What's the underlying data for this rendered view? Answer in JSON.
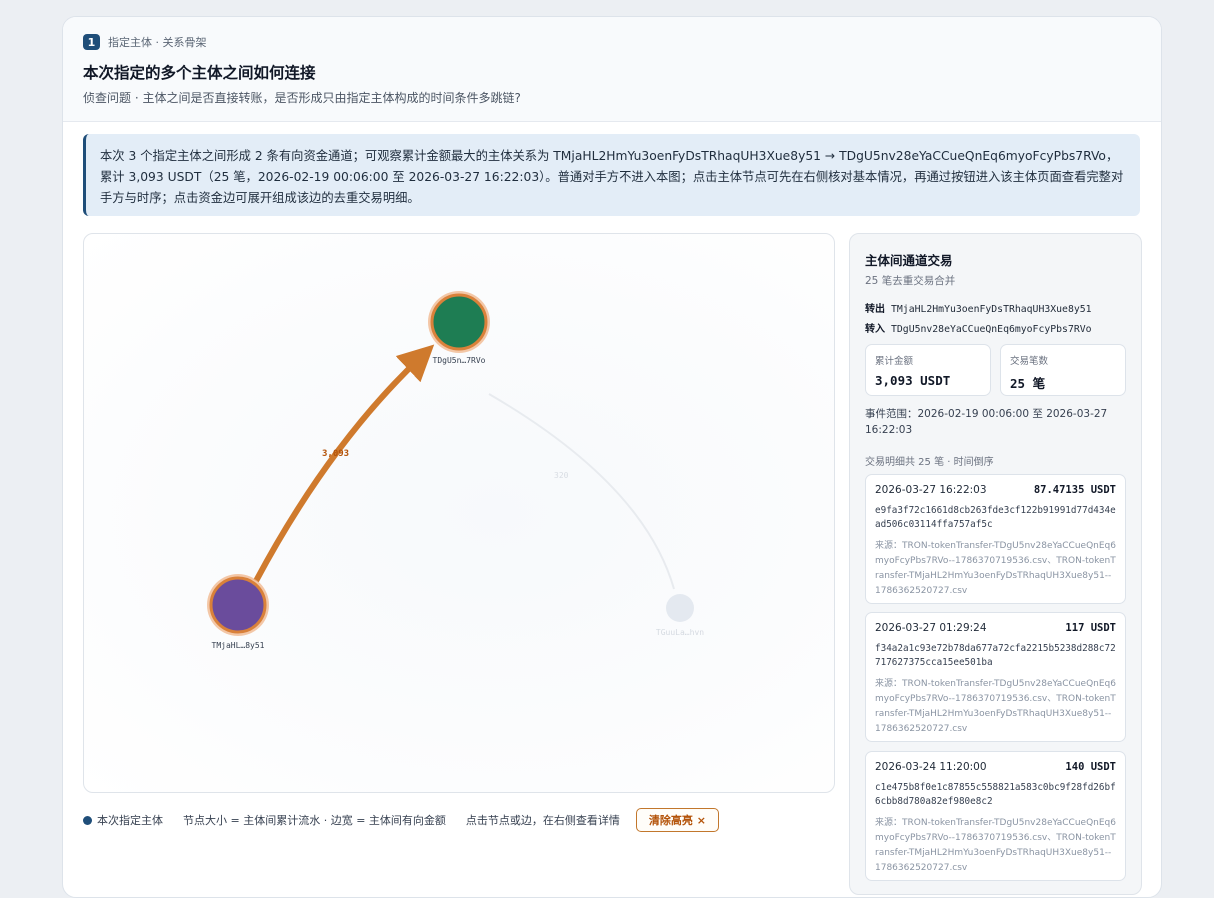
{
  "header": {
    "step_number": "1",
    "step_label": "指定主体 · 关系骨架",
    "title": "本次指定的多个主体之间如何连接",
    "subtitle": "侦查问题 · 主体之间是否直接转账，是否形成只由指定主体构成的时间条件多跳链?"
  },
  "notice": {
    "text": "本次 3 个指定主体之间形成 2 条有向资金通道；可观察累计金额最大的主体关系为 TMjaHL2HmYu3oenFyDsTRhaqUH3Xue8y51 → TDgU5nv28eYaCCueQnEq6myoFcyPbs7RVo，累计 3,093 USDT（25 笔，2026-02-19 00:06:00 至 2026-03-27 16:22:03）。普通对手方不进入本图；点击主体节点可先在右侧核对基本情况，再通过按钮进入该主体页面查看完整对手方与时序；点击资金边可展开组成该边的去重交易明细。"
  },
  "graph": {
    "nodes": [
      {
        "id": "n1",
        "label": "TDgU5n…7RVo",
        "color": "#1e7d53",
        "highlighted": true
      },
      {
        "id": "n2",
        "label": "TMjaHL…8y51",
        "color": "#6a4c9c",
        "highlighted": true
      },
      {
        "id": "n3",
        "label": "TGuuLa…hvn",
        "color": "#cbd5e1",
        "highlighted": false
      }
    ],
    "edges": [
      {
        "from": "n2",
        "to": "n1",
        "label": "3,093",
        "color": "#cf7a2d",
        "highlighted": true
      },
      {
        "from": "n1",
        "to": "n3",
        "label": "320",
        "color": "#e5e7eb",
        "highlighted": false
      }
    ]
  },
  "legend": {
    "designated": "本次指定主体",
    "size_note": "节点大小 = 主体间累计流水 · 边宽 = 主体间有向金额",
    "click_note": "点击节点或边，在右侧查看详情",
    "clear_button": "清除高亮 ×",
    "designated_color": "#1f4e79"
  },
  "panel": {
    "title": "主体间通道交易",
    "subtitle": "25 笔去重交易合并",
    "out_label": "转出",
    "out_addr": "TMjaHL2HmYu3oenFyDsTRhaqUH3Xue8y51",
    "in_label": "转入",
    "in_addr": "TDgU5nv28eYaCCueQnEq6myoFcyPbs7RVo",
    "total_label": "累计金额",
    "total_value": "3,093 USDT",
    "count_label": "交易笔数",
    "count_value": "25 笔",
    "range_text": "事件范围：2026-02-19 00:06:00 至 2026-03-27 16:22:03",
    "detail_head": "交易明细共 25 笔 · 时间倒序",
    "transactions": [
      {
        "time": "2026-03-27 16:22:03",
        "amount": "87.47135 USDT",
        "hash": "e9fa3f72c1661d8cb263fde3cf122b91991d77d434ead506c03114ffa757af5c",
        "source": "来源：TRON-tokenTransfer-TDgU5nv28eYaCCueQnEq6myoFcyPbs7RVo--1786370719536.csv、TRON-tokenTransfer-TMjaHL2HmYu3oenFyDsTRhaqUH3Xue8y51--1786362520727.csv"
      },
      {
        "time": "2026-03-27 01:29:24",
        "amount": "117 USDT",
        "hash": "f34a2a1c93e72b78da677a72cfa2215b5238d288c72717627375cca15ee501ba",
        "source": "来源：TRON-tokenTransfer-TDgU5nv28eYaCCueQnEq6myoFcyPbs7RVo--1786370719536.csv、TRON-tokenTransfer-TMjaHL2HmYu3oenFyDsTRhaqUH3Xue8y51--1786362520727.csv"
      },
      {
        "time": "2026-03-24 11:20:00",
        "amount": "140 USDT",
        "hash": "c1e475b8f0e1c87855c558821a583c0bc9f28fd26bf6cbb8d780a82ef980e8c2",
        "source": "来源：TRON-tokenTransfer-TDgU5nv28eYaCCueQnEq6myoFcyPbs7RVo--1786370719536.csv、TRON-tokenTransfer-TMjaHL2HmYu3oenFyDsTRhaqUH3Xue8y51--1786362520727.csv"
      }
    ]
  }
}
